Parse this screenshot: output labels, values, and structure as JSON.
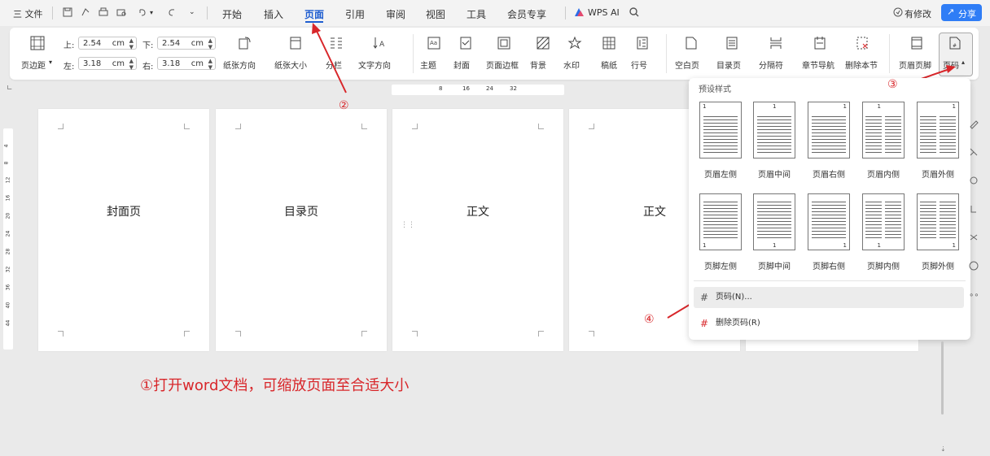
{
  "menu": {
    "label": "三 文件"
  },
  "tabs": [
    {
      "label": "开始",
      "active": false
    },
    {
      "label": "插入",
      "active": false
    },
    {
      "label": "页面",
      "active": true
    },
    {
      "label": "引用",
      "active": false
    },
    {
      "label": "审阅",
      "active": false
    },
    {
      "label": "视图",
      "active": false
    },
    {
      "label": "工具",
      "active": false
    },
    {
      "label": "会员专享",
      "active": false
    }
  ],
  "wps_ai": {
    "label": "WPS AI"
  },
  "top_right": {
    "modified_label": "有修改",
    "share_label": "分享"
  },
  "ribbon": {
    "margins_label": "页边距",
    "top_label": "上:",
    "top_value": "2.54",
    "bottom_label": "下:",
    "bottom_value": "2.54",
    "left_label": "左:",
    "left_value": "3.18",
    "right_label": "右:",
    "right_value": "3.18",
    "unit": "cm",
    "buttons": [
      "纸张方向",
      "纸张大小",
      "分栏",
      "文字方向",
      "主题",
      "封面",
      "页面边框",
      "背景",
      "水印",
      "稿纸",
      "行号",
      "空白页",
      "目录页",
      "分隔符",
      "章节导航",
      "删除本节",
      "页眉页脚",
      "页码"
    ]
  },
  "ruler": {
    "h_ticks": [
      "8",
      "16",
      "24",
      "32"
    ],
    "v_ticks": [
      "4",
      "8",
      "12",
      "16",
      "20",
      "24",
      "28",
      "32",
      "36",
      "40",
      "44"
    ]
  },
  "pages": [
    {
      "title": "封面页"
    },
    {
      "title": "目录页"
    },
    {
      "title": "正文"
    },
    {
      "title": "正文"
    }
  ],
  "annotations": {
    "n1": "②",
    "n2": "③",
    "n3": "④"
  },
  "instruction": "①打开word文档，可缩放页面至合适大小",
  "dropdown": {
    "section_title": "预设样式",
    "header_styles": [
      "页眉左侧",
      "页眉中间",
      "页眉右侧",
      "页眉内侧",
      "页眉外侧"
    ],
    "footer_styles": [
      "页脚左侧",
      "页脚中间",
      "页脚右侧",
      "页脚内侧",
      "页脚外侧"
    ],
    "page_num_item": "页码(N)...",
    "delete_item": "删除页码(R)"
  },
  "colors": {
    "accent": "#1e5dd0",
    "annotation": "#d8262a"
  }
}
